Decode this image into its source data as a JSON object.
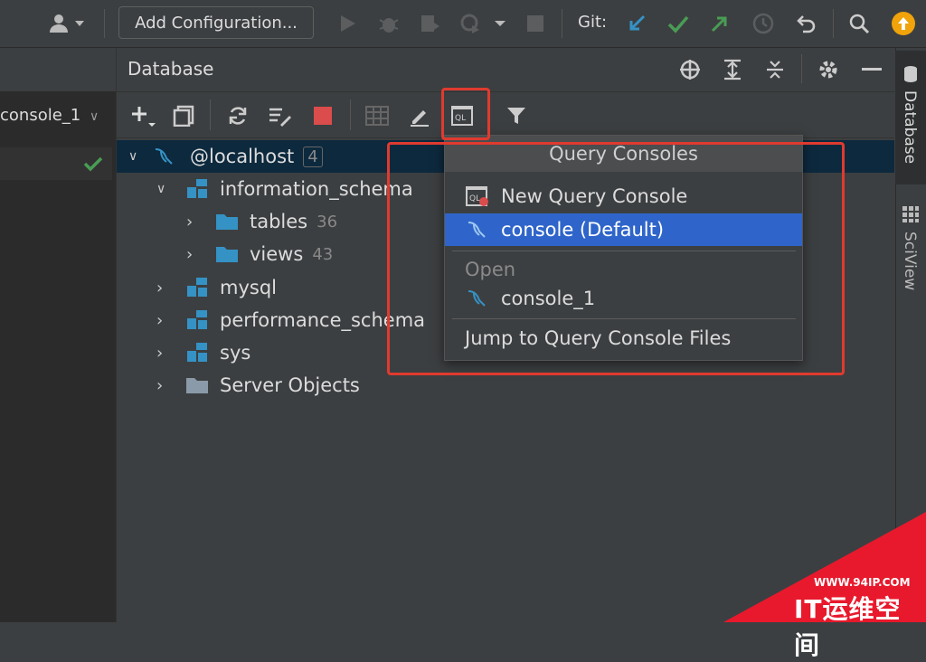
{
  "toolbar": {
    "add_configuration": "Add Configuration...",
    "git_label": "Git:",
    "colors": {
      "git_update": "#3592c4",
      "git_commit": "#499c54",
      "git_push": "#499c54",
      "update_badge": "#f0a30a"
    }
  },
  "left_panel": {
    "tab_label": "console_1"
  },
  "right_strip": {
    "database_tab": "Database",
    "sciview_tab": "SciView"
  },
  "database": {
    "title": "Database",
    "tree": [
      {
        "label": "@localhost",
        "count": "4"
      },
      {
        "label": "information_schema"
      },
      {
        "label": "tables",
        "count": "36"
      },
      {
        "label": "views",
        "count": "43"
      },
      {
        "label": "mysql"
      },
      {
        "label": "performance_schema"
      },
      {
        "label": "sys"
      },
      {
        "label": "Server Objects"
      }
    ]
  },
  "popup": {
    "title": "Query Consoles",
    "new_console": "New Query Console",
    "default_console": "console (Default)",
    "open_header": "Open",
    "console_1": "console_1",
    "jump": "Jump to Query Console Files"
  },
  "watermark": {
    "url": "WWW.94IP.COM",
    "text": "IT运维空间"
  }
}
